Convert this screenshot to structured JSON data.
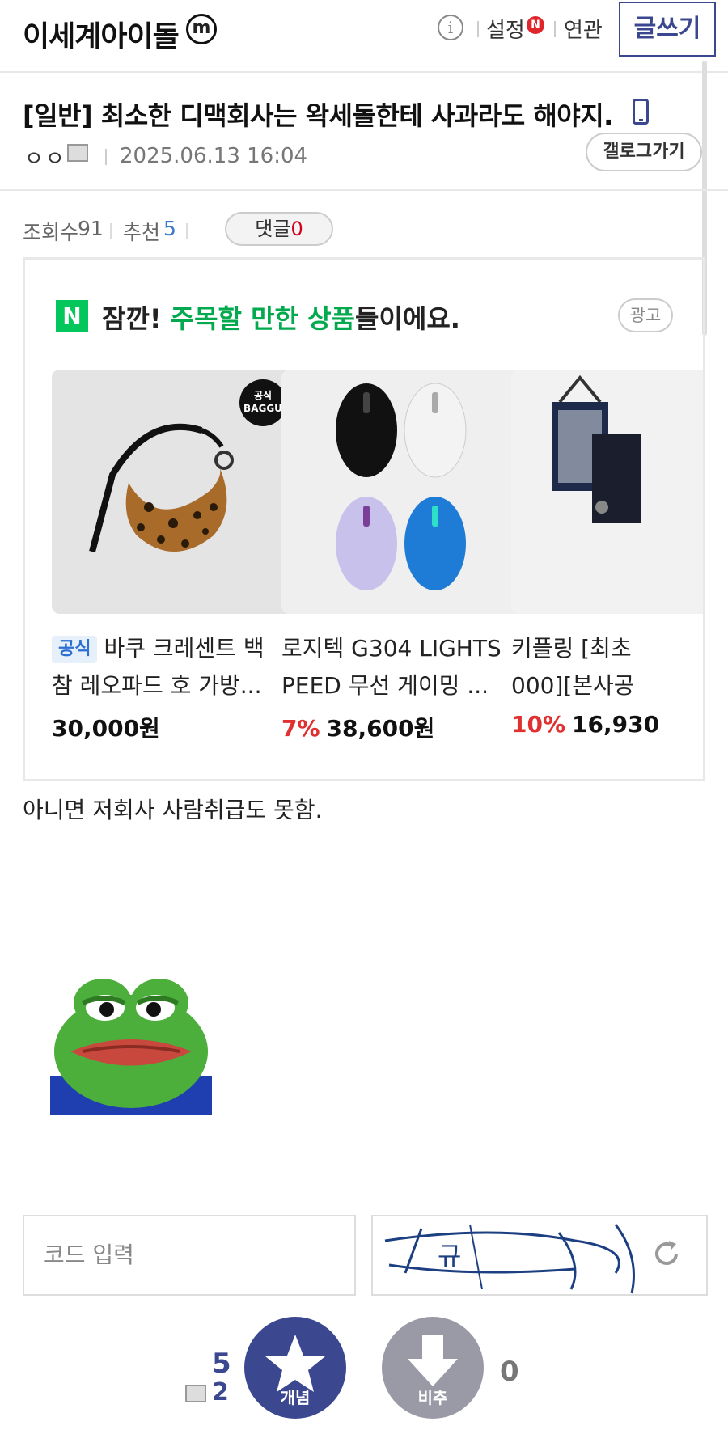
{
  "header": {
    "gallery_title": "이세계아이돌",
    "minor_badge": "m",
    "info_icon": "i",
    "settings_label": "설정",
    "settings_badge": "N",
    "related_label": "연관",
    "write_label": "글쓰기"
  },
  "post": {
    "title": "[일반] 최소한 디맥회사는 왁세돌한테 사과라도 해야지.",
    "author": "ㅇㅇ",
    "date": "2025.06.13 16:04",
    "gallery_button": "갤로그가기",
    "views_label": "조회수",
    "views_value": "91",
    "recommend_label": "추천",
    "recommend_value": "5",
    "comment_label": "댓글",
    "comment_value": "0",
    "body_text": "아니면 저회사 사람취급도 못함."
  },
  "ad": {
    "n_logo": "N",
    "headline_pre": "잠깐! ",
    "headline_highlight": "주목할 만한 상품",
    "headline_post": "들이에요.",
    "ad_tag": "광고",
    "products": [
      {
        "official": "공식",
        "name_line1": "바쿠 크레센트 백",
        "name_line2": "참 레오파드 호 가방...",
        "discount": "",
        "price": "30,000원",
        "badge_line1": "공식",
        "badge_line2": "BAGGU"
      },
      {
        "official": "",
        "name_line1": "로지텍 G304 LIGHTS",
        "name_line2": "PEED 무선 게이밍 ...",
        "discount": "7%",
        "price": "38,600원"
      },
      {
        "official": "",
        "name_line1": "키플링 [최초",
        "name_line2": "000][본사공",
        "discount": "10%",
        "price": "16,930"
      }
    ]
  },
  "captcha": {
    "placeholder": "코드 입력",
    "image_text": "규"
  },
  "vote": {
    "up_count": "5",
    "fixed_count": "2",
    "up_label": "개념",
    "down_label": "비추",
    "down_count": "0"
  },
  "colors": {
    "brand": "#3b4890",
    "naver_green": "#03c75a",
    "discount_red": "#e03030"
  }
}
